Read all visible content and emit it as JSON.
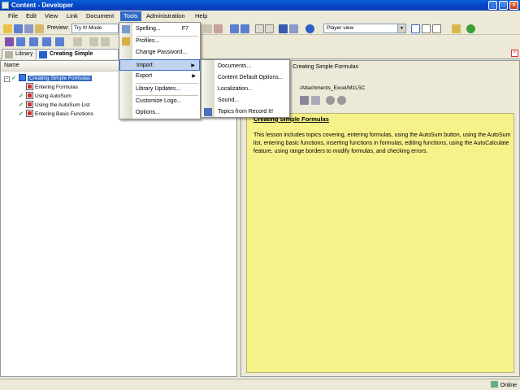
{
  "window": {
    "title": "Content - Developer"
  },
  "menubar": [
    "File",
    "Edit",
    "View",
    "Link",
    "Document",
    "Tools",
    "Administration",
    "Help"
  ],
  "toolbar": {
    "preview_label": "Preview:",
    "preview_mode": "Try It! Mode",
    "player_view": "Player view"
  },
  "tabs": {
    "library": "Library",
    "editor": "Creating Simple Formulas"
  },
  "tree": {
    "column_header": "Name",
    "items": [
      "Creating Simple Formulas",
      "Entering Formulas",
      "Using AutoSum",
      "Using the AutoSum List",
      "Entering Basic Functions"
    ]
  },
  "editor": {
    "header_prefix": "r:",
    "header_title": "Creating Simple Formulas",
    "path": "/Attachments_Excel/M1L5C",
    "content_title": "Creating Simple Formulas",
    "content_body": "This lesson includes topics covering, entering formulas, using the AutoSum button, using the AutoSum list, entering basic functions, inserting functions in formulas, editing functions, using the AutoCalculate feature, using range borders to modify formulas, and checking errors."
  },
  "tools_menu": {
    "items": [
      {
        "label": "Spelling...",
        "shortcut": "F7"
      },
      {
        "label": "Profiles..."
      },
      {
        "label": "Change Password..."
      },
      {
        "label": "Import"
      },
      {
        "label": "Export"
      },
      {
        "label": "Library Updates..."
      },
      {
        "label": "Customize Logo..."
      },
      {
        "label": "Options..."
      }
    ]
  },
  "import_menu": {
    "items": [
      "Documents...",
      "Content Default Options...",
      "Localization...",
      "Sound...",
      "Topics from Record It!"
    ]
  },
  "status": {
    "text": "Online"
  }
}
